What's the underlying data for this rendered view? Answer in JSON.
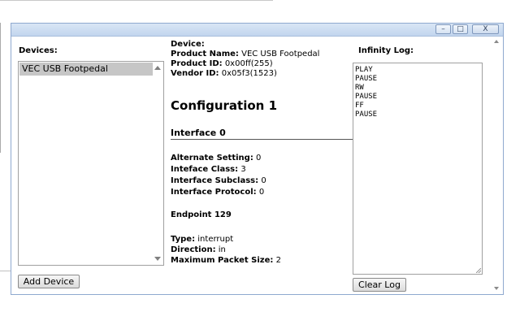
{
  "window": {
    "controls": {
      "minimize": "–",
      "maximize": "□",
      "close": "X"
    }
  },
  "devices": {
    "label": "Devices:",
    "items": [
      "VEC USB Footpedal"
    ],
    "add_button": "Add Device"
  },
  "device_info": {
    "heading": "Device:",
    "product_name_label": "Product Name:",
    "product_name": "VEC USB Footpedal",
    "product_id_label": "Product ID:",
    "product_id": "0x00ff(255)",
    "vendor_id_label": "Vendor ID:",
    "vendor_id": "0x05f3(1523)",
    "configuration_title": "Configuration 1",
    "interface_title": "Interface 0",
    "alternate_setting_label": "Alternate Setting:",
    "alternate_setting": "0",
    "interface_class_label": "Inteface Class:",
    "interface_class": "3",
    "interface_subclass_label": "Interface Subclass:",
    "interface_subclass": "0",
    "interface_protocol_label": "Interface Protocol:",
    "interface_protocol": "0",
    "endpoint_title": "Endpoint 129",
    "type_label": "Type:",
    "type": "interrupt",
    "direction_label": "Direction:",
    "direction": "in",
    "max_packet_label": "Maximum Packet Size:",
    "max_packet": "2"
  },
  "log": {
    "label": "Infinity Log:",
    "entries": [
      "PLAY",
      "PAUSE",
      "RW",
      "PAUSE",
      "FF",
      "PAUSE"
    ],
    "clear_button": "Clear Log"
  }
}
